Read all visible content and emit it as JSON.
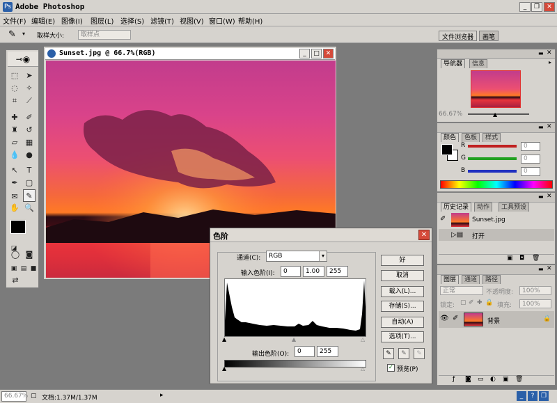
{
  "app": {
    "title": "Adobe Photoshop"
  },
  "menu": [
    "文件(F)",
    "编辑(E)",
    "图像(I)",
    "图层(L)",
    "选择(S)",
    "滤镜(T)",
    "视图(V)",
    "窗口(W)",
    "帮助(H)"
  ],
  "options": {
    "sample_label": "取样大小:",
    "sample_value": "取样点"
  },
  "workspace_tabs": [
    "文件浏览器",
    "画笔"
  ],
  "document": {
    "title": "Sunset.jpg @ 66.7%(RGB)"
  },
  "navigator": {
    "tabs": [
      "导航器",
      "信息"
    ],
    "zoom": "66.67%"
  },
  "color": {
    "tabs": [
      "颜色",
      "色板",
      "样式"
    ],
    "channels": [
      "R",
      "G",
      "B"
    ],
    "values": [
      "0",
      "0",
      "0"
    ]
  },
  "history": {
    "tabs": [
      "历史记录",
      "动作",
      "工具预设"
    ],
    "snapshot": "Sunset.jpg",
    "step": "打开"
  },
  "layers": {
    "tabs": [
      "图层",
      "通道",
      "路径"
    ],
    "blend_mode": "正常",
    "opacity_label": "不透明度:",
    "opacity": "100%",
    "lock_label": "锁定:",
    "fill_label": "填充:",
    "fill": "100%",
    "layer_name": "背景"
  },
  "levels": {
    "title": "色阶",
    "channel_label": "通道(C):",
    "channel": "RGB",
    "input_label": "输入色阶(I):",
    "input": [
      "0",
      "1.00",
      "255"
    ],
    "output_label": "输出色阶(O):",
    "output": [
      "0",
      "255"
    ],
    "buttons": {
      "ok": "好",
      "cancel": "取消",
      "load": "载入(L)...",
      "save": "存储(S)...",
      "auto": "自动(A)",
      "options": "选项(T)..."
    },
    "preview": "预览(P)"
  },
  "status": {
    "zoom": "66.67%",
    "doc": "文档:1.37M/1.37M"
  }
}
